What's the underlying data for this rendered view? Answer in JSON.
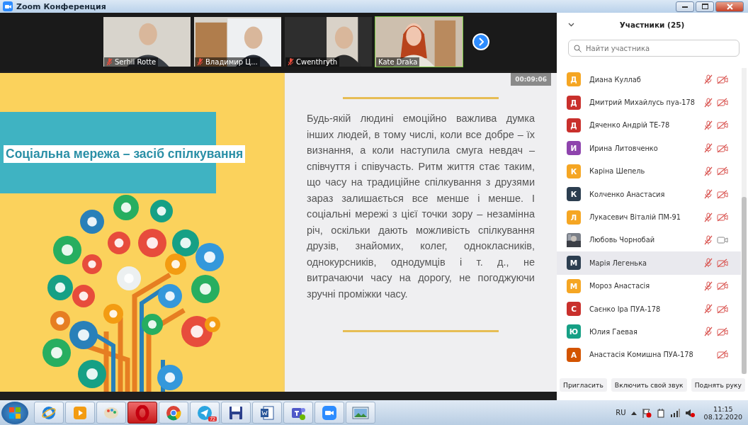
{
  "window": {
    "title": "Zoom Конференция"
  },
  "videos": [
    {
      "name": "Serhii Rotte",
      "muted": true,
      "speaking": false
    },
    {
      "name": "Владимир Ц...",
      "muted": true,
      "speaking": false
    },
    {
      "name": "Cwenthryth",
      "muted": true,
      "speaking": false
    },
    {
      "name": "Kate Draka",
      "muted": false,
      "speaking": true
    }
  ],
  "share": {
    "timer": "00:09:06",
    "slide_title": "Соціальна мережа – засіб спілкування",
    "paragraph": "Будь-якій людині емоційно важлива думка інших людей, в тому числі, коли все добре – їх визнання, а коли наступила смуга невдач – співчуття і співучасть. Ритм життя стає таким, що часу на традиційне спілкування з друзями зараз залишається все менше і менше. І соціальні мережі з цієї точки зору – незамінна річ, оскільки дають можливість спілкування друзів, знайомих, колег, однокласників, однокурсників, однодумців і т. д., не витрачаючи часу на дорогу, не погоджуючи зручні проміжки часу."
  },
  "participants_panel": {
    "title": "Участники (25)",
    "search": {
      "placeholder": "Найти участника"
    },
    "participants": [
      {
        "has_photo": false,
        "initial": "Д",
        "color": "#f5a623",
        "name": "Диана Куллаб",
        "audio_connected": true,
        "mic_muted": true,
        "video_on": false,
        "selected": false
      },
      {
        "has_photo": false,
        "initial": "Д",
        "color": "#c9302c",
        "name": "Дмитрий Михайлусь пуа-178",
        "audio_connected": true,
        "mic_muted": true,
        "video_on": false,
        "selected": false
      },
      {
        "has_photo": false,
        "initial": "Д",
        "color": "#c9302c",
        "name": "Дяченко Андрій ТЕ-78",
        "audio_connected": true,
        "mic_muted": true,
        "video_on": false,
        "selected": false
      },
      {
        "has_photo": false,
        "initial": "И",
        "color": "#8e44ad",
        "name": "Ирина Литовченко",
        "audio_connected": true,
        "mic_muted": true,
        "video_on": false,
        "selected": false
      },
      {
        "has_photo": false,
        "initial": "К",
        "color": "#f5a623",
        "name": "Каріна Шепель",
        "audio_connected": true,
        "mic_muted": true,
        "video_on": false,
        "selected": false
      },
      {
        "has_photo": false,
        "initial": "К",
        "color": "#2c3e50",
        "name": "Колченко Анастасия",
        "audio_connected": true,
        "mic_muted": true,
        "video_on": false,
        "selected": false
      },
      {
        "has_photo": false,
        "initial": "Л",
        "color": "#f5a623",
        "name": "Лукасевич Віталій ПМ-91",
        "audio_connected": true,
        "mic_muted": true,
        "video_on": false,
        "selected": false
      },
      {
        "has_photo": true,
        "name": "Любовь Чорнобай",
        "audio_connected": true,
        "mic_muted": true,
        "video_on": true,
        "selected": false
      },
      {
        "has_photo": false,
        "initial": "М",
        "color": "#2c3e50",
        "name": "Марія Легенька",
        "audio_connected": true,
        "mic_muted": true,
        "video_on": false,
        "selected": true
      },
      {
        "has_photo": false,
        "initial": "М",
        "color": "#f5a623",
        "name": "Мороз Анастасія",
        "audio_connected": true,
        "mic_muted": true,
        "video_on": false,
        "selected": false
      },
      {
        "has_photo": false,
        "initial": "С",
        "color": "#c9302c",
        "name": "Саєнко Іра ПУА-178",
        "audio_connected": true,
        "mic_muted": true,
        "video_on": false,
        "selected": false
      },
      {
        "has_photo": false,
        "initial": "Ю",
        "color": "#16a085",
        "name": "Юлия Гаевая",
        "audio_connected": true,
        "mic_muted": true,
        "video_on": false,
        "selected": false
      },
      {
        "has_photo": false,
        "initial": "А",
        "color": "#d35400",
        "name": "Анастасія Комишна ПУА-178",
        "audio_connected": false,
        "video_on": false,
        "selected": false
      }
    ],
    "buttons": [
      "Пригласить",
      "Включить свой звук",
      "Поднять руку"
    ]
  },
  "taskbar": {
    "apps": [
      {
        "kind": "ie",
        "active": false
      },
      {
        "kind": "media",
        "active": false
      },
      {
        "kind": "paint",
        "active": false
      },
      {
        "kind": "opera",
        "active": true
      },
      {
        "kind": "chrome",
        "active": false
      },
      {
        "kind": "telegram",
        "active": false,
        "badge": "72"
      },
      {
        "kind": "save",
        "active": false
      },
      {
        "kind": "word",
        "active": false
      },
      {
        "kind": "teams",
        "active": false
      },
      {
        "kind": "zoom",
        "active": false
      },
      {
        "kind": "viewer",
        "active": false
      }
    ],
    "language": "RU",
    "time": "11:15",
    "date": "08.12.2020"
  }
}
